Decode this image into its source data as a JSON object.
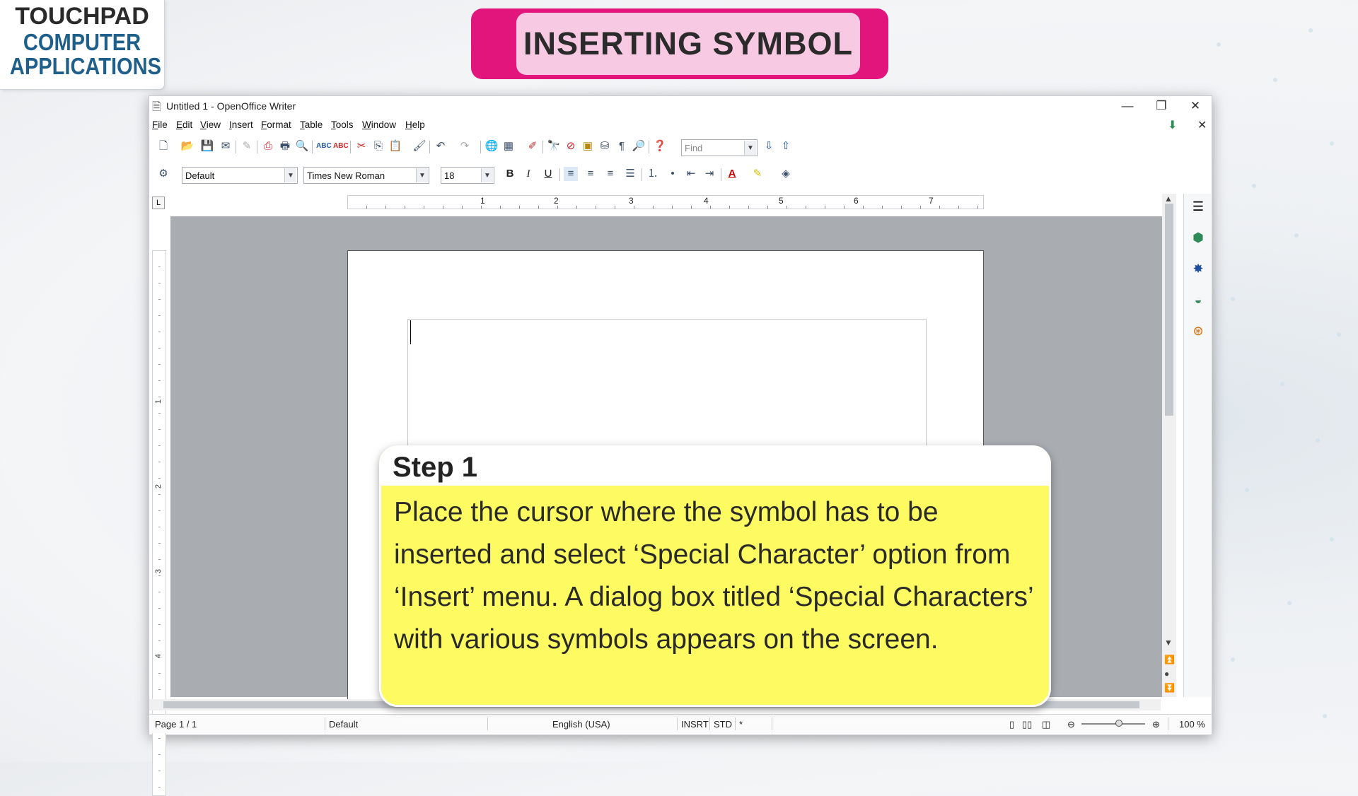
{
  "logo": {
    "brand": "TOUCHPAD",
    "line1": "COMPUTER",
    "line2": "APPLICATIONS"
  },
  "banner": {
    "title": "INSERTING SYMBOL"
  },
  "window": {
    "title": "Untitled 1 - OpenOffice Writer",
    "minimize": "—",
    "restore": "❐",
    "close": "✕"
  },
  "menu": [
    "File",
    "Edit",
    "View",
    "Insert",
    "Format",
    "Table",
    "Tools",
    "Window",
    "Help"
  ],
  "toolbar": {
    "find_placeholder": "Find",
    "style_value": "Default",
    "font_value": "Times New Roman",
    "size_value": "18",
    "bold": "B",
    "italic": "I",
    "underline": "U",
    "font_color": "A"
  },
  "ruler": {
    "numbers": [
      "1",
      "2",
      "3",
      "4",
      "5",
      "6",
      "7"
    ],
    "vnumbers": [
      "1",
      "2",
      "3",
      "4"
    ]
  },
  "status": {
    "page": "Page 1 / 1",
    "style": "Default",
    "language": "English (USA)",
    "insert_mode": "INSRT",
    "selection_mode": "STD",
    "modified": "*",
    "zoom": "100 %"
  },
  "callout": {
    "title": "Step 1",
    "body": "Place the cursor where the symbol has to be inserted and select ‘Special Character’ option from ‘Insert’ menu. A dialog box titled ‘Special Characters’ with various symbols appears on the screen."
  }
}
